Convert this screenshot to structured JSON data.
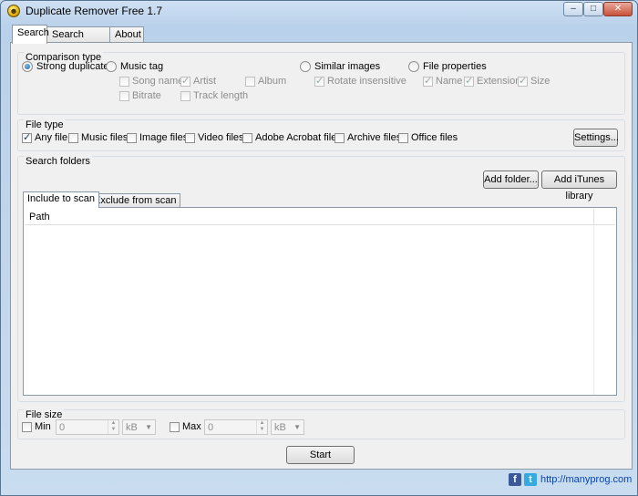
{
  "window": {
    "title": "Duplicate Remover Free 1.7",
    "min": "–",
    "max": "□",
    "close": "✕"
  },
  "tabs": [
    {
      "label": "Search",
      "active": true
    },
    {
      "label": "Search result",
      "active": false
    },
    {
      "label": "About",
      "active": false
    }
  ],
  "comparison": {
    "title": "Comparison type",
    "strong": "Strong duplicate",
    "music_tag": "Music tag",
    "song_name": "Song name",
    "artist": "Artist",
    "album": "Album",
    "bitrate": "Bitrate",
    "track_length": "Track length",
    "similar_images": "Similar images",
    "rotate_insensitive": "Rotate insensitive",
    "file_properties": "File properties",
    "name": "Name",
    "extension": "Extension",
    "size": "Size"
  },
  "file_type": {
    "title": "File type",
    "any": "Any file",
    "music": "Music files",
    "image": "Image files",
    "video": "Video files",
    "acrobat": "Adobe Acrobat files",
    "archive": "Archive files",
    "office": "Office files",
    "settings": "Settings..."
  },
  "folders": {
    "title": "Search folders",
    "add_folder": "Add folder...",
    "add_itunes": "Add iTunes library",
    "include_tab": "Include to scan",
    "exclude_tab": "Exclude from scan",
    "path_column": "Path"
  },
  "file_size": {
    "title": "File size",
    "min": "Min",
    "max": "Max",
    "min_value": "0",
    "max_value": "0",
    "min_unit": "kB",
    "max_unit": "kB"
  },
  "start": "Start",
  "footer": {
    "fb": "f",
    "tw": "t",
    "link": "http://manyprog.com"
  },
  "colors": {
    "link": "#0b44aa",
    "facebook": "#3b5998",
    "twitter": "#35a9e0"
  }
}
